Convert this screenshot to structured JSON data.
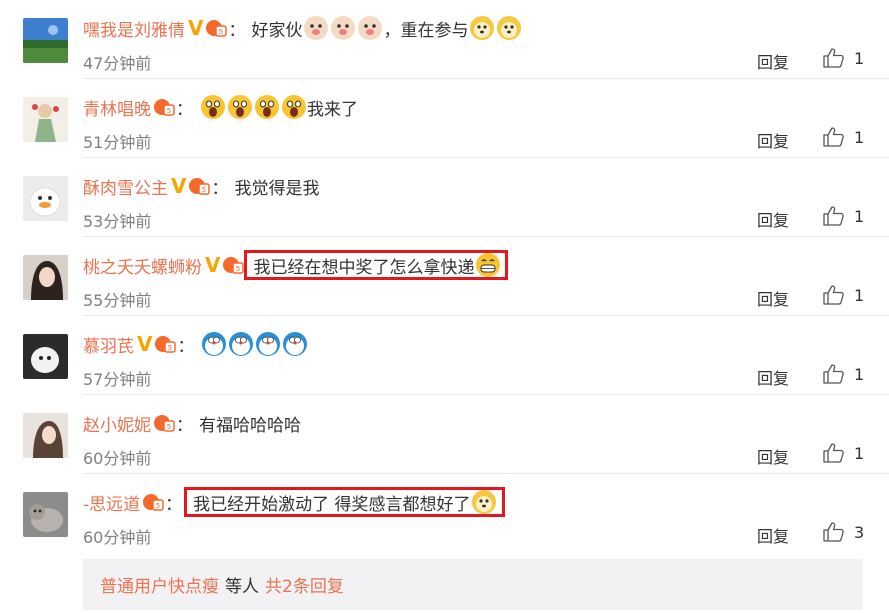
{
  "comments": [
    {
      "username": "嘿我是刘雅倩",
      "verified": true,
      "text_before": "好家伙",
      "text_after": "，重在参与",
      "time": "47分钟前",
      "reply": "回复",
      "likes": "1",
      "highlight": false,
      "emojis_mid": [
        "dog-face-emoji",
        "dog-face-emoji",
        "dog-face-emoji"
      ],
      "emojis_end": [
        "doge-emoji",
        "doge-emoji"
      ]
    },
    {
      "username": "青林唱晚",
      "verified": false,
      "text_before": "",
      "text_after": "我来了",
      "time": "51分钟前",
      "reply": "回复",
      "likes": "1",
      "highlight": false,
      "emojis_mid": [
        "shocked-emoji",
        "shocked-emoji",
        "shocked-emoji",
        "shocked-emoji"
      ],
      "emojis_end": []
    },
    {
      "username": "酥肉雪公主",
      "verified": true,
      "text_before": "我觉得是我",
      "text_after": "",
      "time": "53分钟前",
      "reply": "回复",
      "likes": "1",
      "highlight": false,
      "emojis_mid": [],
      "emojis_end": []
    },
    {
      "username": "桃之夭夭螺蛳粉",
      "verified": true,
      "text_before": "我已经在想中奖了怎么拿快递",
      "text_after": "",
      "time": "55分钟前",
      "reply": "回复",
      "likes": "1",
      "highlight": true,
      "emojis_mid": [
        "grin-emoji"
      ],
      "emojis_end": []
    },
    {
      "username": "慕羽芪",
      "verified": true,
      "text_before": "",
      "text_after": "",
      "time": "57分钟前",
      "reply": "回复",
      "likes": "1",
      "highlight": false,
      "emojis_mid": [
        "doraemon-emoji",
        "doraemon-emoji",
        "doraemon-emoji",
        "doraemon-emoji"
      ],
      "emojis_end": []
    },
    {
      "username": "赵小妮妮",
      "verified": false,
      "text_before": "有福哈哈哈哈",
      "text_after": "",
      "time": "60分钟前",
      "reply": "回复",
      "likes": "1",
      "highlight": false,
      "emojis_mid": [],
      "emojis_end": []
    },
    {
      "username": "-思远道",
      "verified": false,
      "text_before": "我已经开始激动了 得奖感言都想好了",
      "text_after": "",
      "time": "60分钟前",
      "reply": "回复",
      "likes": "3",
      "highlight": true,
      "emojis_mid": [
        "doge-emoji"
      ],
      "emojis_end": []
    }
  ],
  "more_replies": {
    "user": "普通用户快点瘦",
    "middle": "等人",
    "count_text": "共2条回复"
  },
  "colors": {
    "username": "#eb7350",
    "highlight": "#e3171e",
    "verified": "#f7a502",
    "muted": "#808080"
  }
}
